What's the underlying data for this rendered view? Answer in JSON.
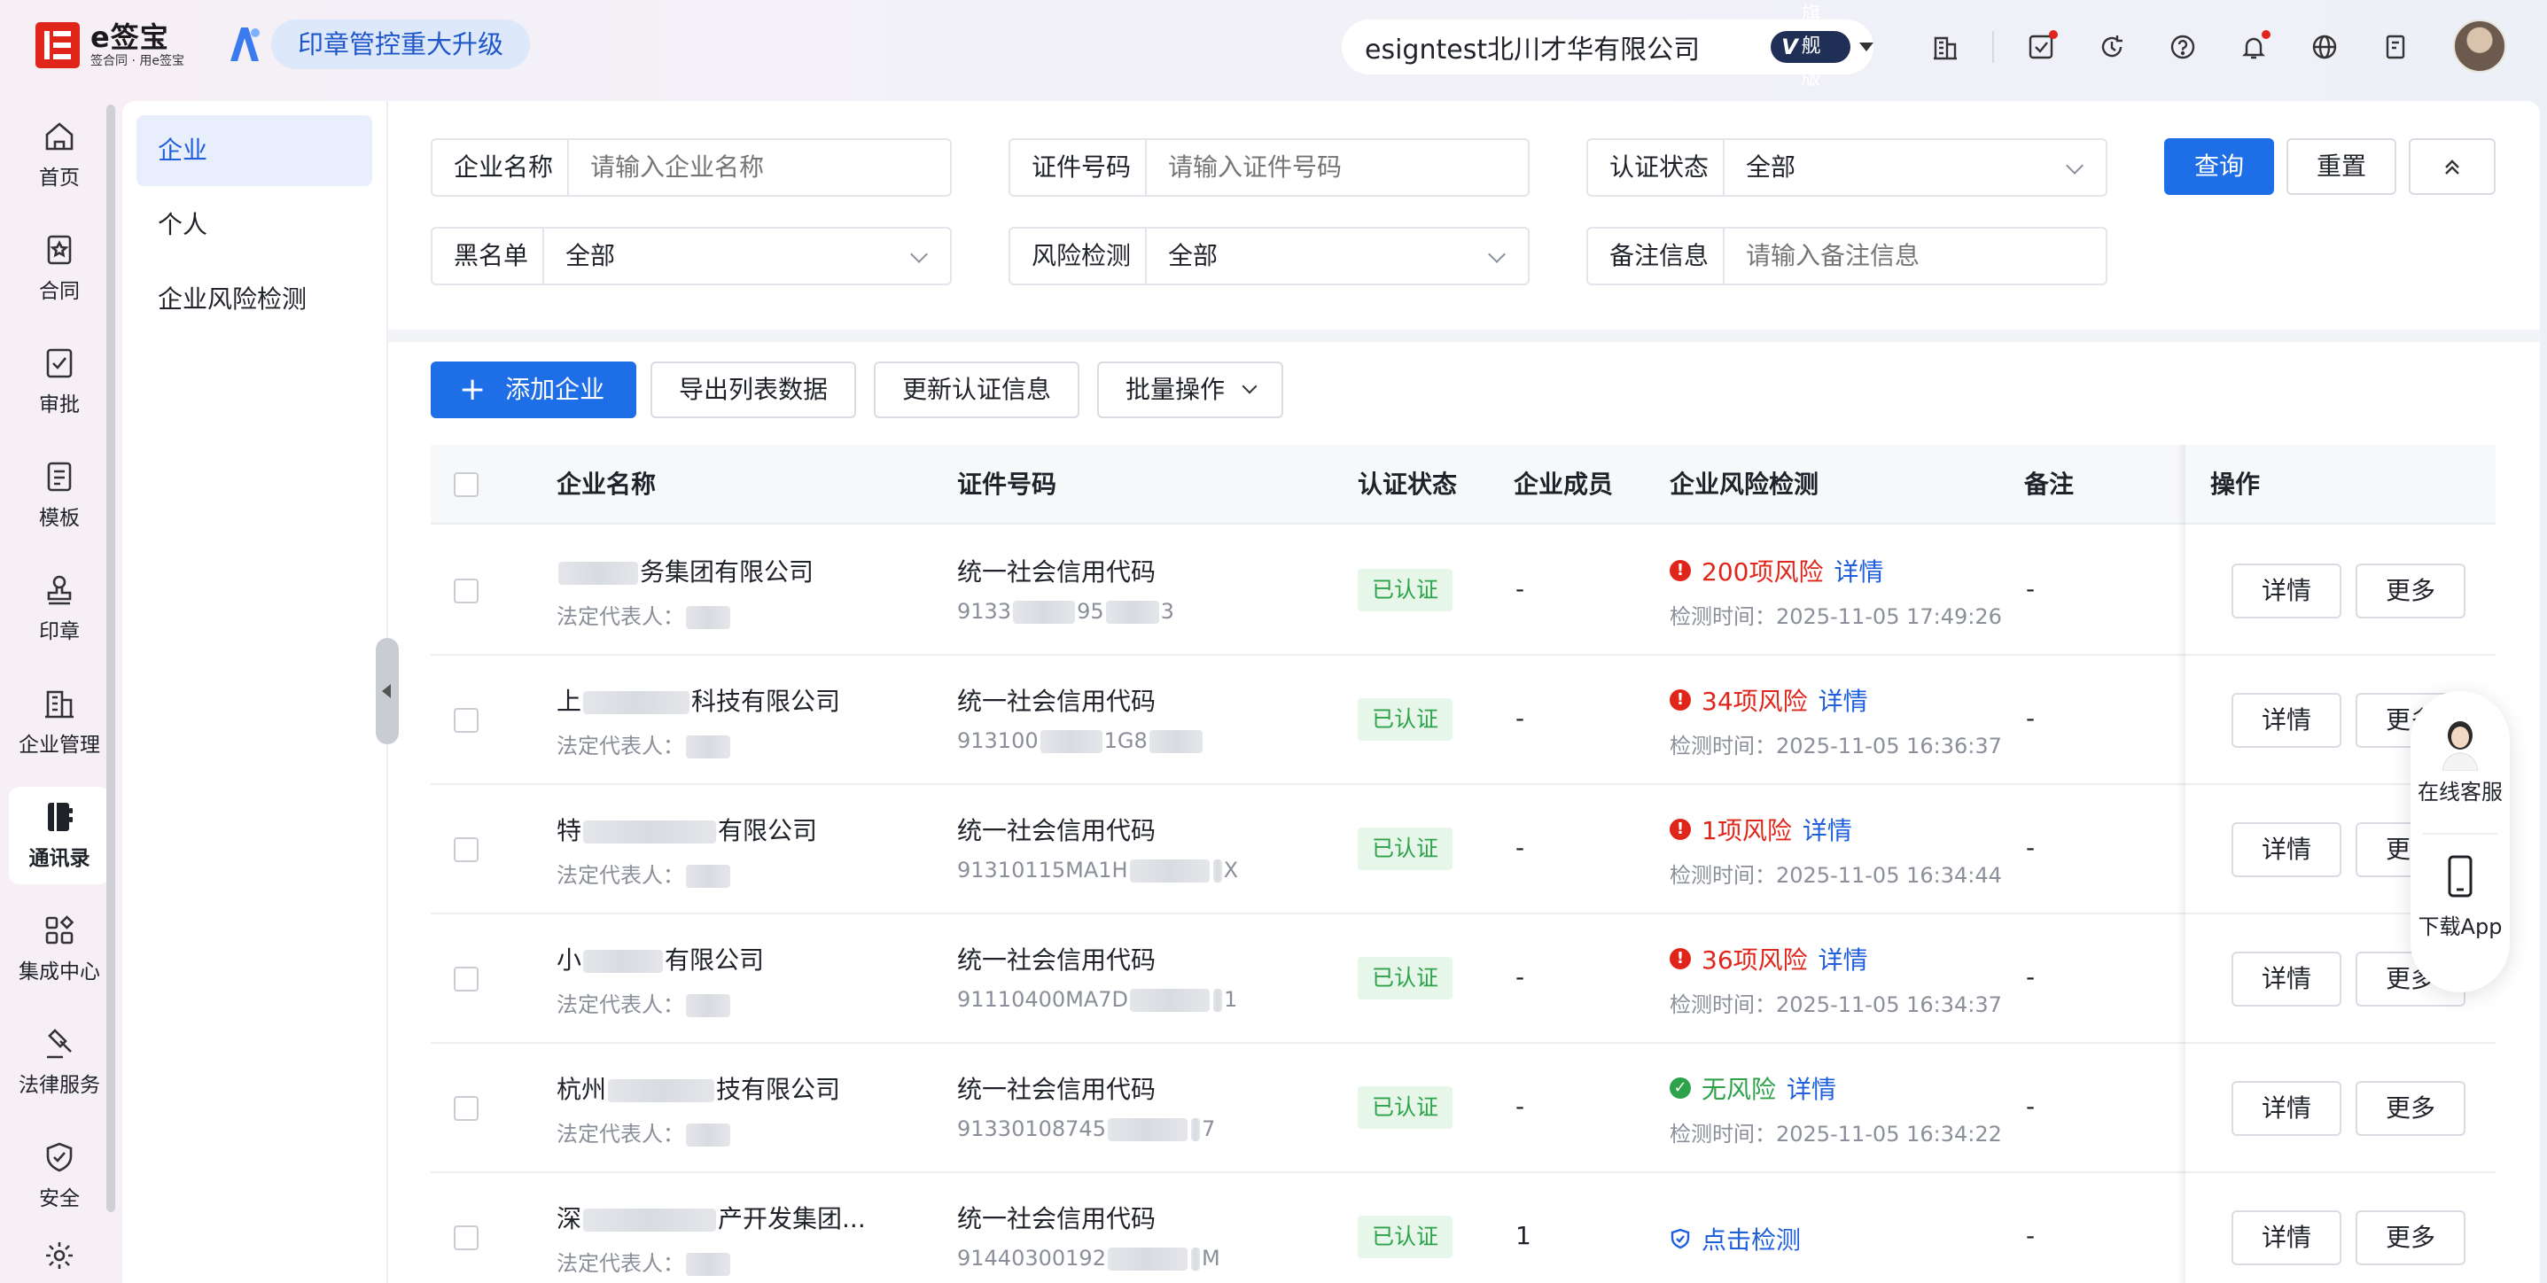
{
  "brand": {
    "logo_title": "e签宝",
    "logo_sub": "签合同 · 用e签宝",
    "promo": "印章管控重大升级"
  },
  "header": {
    "company": "esigntest北川才华有限公司",
    "tier": "旗舰版",
    "tier_mark": "V",
    "icons": [
      "building-icon",
      "todo-icon",
      "refresh-icon",
      "help-icon",
      "bell-icon",
      "globe-icon",
      "document-icon"
    ]
  },
  "rail": {
    "items": [
      {
        "label": "首页",
        "icon": "home-icon"
      },
      {
        "label": "合同",
        "icon": "contract-icon"
      },
      {
        "label": "审批",
        "icon": "approval-icon"
      },
      {
        "label": "模板",
        "icon": "template-icon"
      },
      {
        "label": "印章",
        "icon": "seal-icon"
      },
      {
        "label": "企业管理",
        "icon": "enterprise-icon"
      },
      {
        "label": "通讯录",
        "icon": "contacts-icon"
      },
      {
        "label": "集成中心",
        "icon": "integration-icon"
      },
      {
        "label": "法律服务",
        "icon": "legal-icon"
      },
      {
        "label": "安全",
        "icon": "shield-icon"
      }
    ],
    "active": "通讯录"
  },
  "subnav": {
    "items": [
      "企业",
      "个人",
      "企业风险检测"
    ],
    "active": "企业"
  },
  "filters": {
    "company_name": {
      "label": "企业名称",
      "placeholder": "请输入企业名称"
    },
    "cert_no": {
      "label": "证件号码",
      "placeholder": "请输入证件号码"
    },
    "auth_status": {
      "label": "认证状态",
      "value": "全部"
    },
    "blacklist": {
      "label": "黑名单",
      "value": "全部"
    },
    "risk_check": {
      "label": "风险检测",
      "value": "全部"
    },
    "remark": {
      "label": "备注信息",
      "placeholder": "请输入备注信息"
    },
    "query": "查询",
    "reset": "重置"
  },
  "toolbar": {
    "add": "添加企业",
    "export": "导出列表数据",
    "update": "更新认证信息",
    "batch": "批量操作"
  },
  "table": {
    "columns": {
      "name": "企业名称",
      "cert": "证件号码",
      "status": "认证状态",
      "members": "企业成员",
      "risk": "企业风险检测",
      "remark": "备注",
      "ops": "操作"
    },
    "rows": [
      {
        "name_a": "",
        "name_b": "务集团有限公司",
        "legal_a": "法定代表人：",
        "cert_type": "统一社会信用代码",
        "cert_a": "9133",
        "cert_b": "95",
        "cert_c": "3",
        "status": "已认证",
        "members": "-",
        "risk_kind": "bad",
        "risk_text": "200项风险",
        "risk_link": "详情",
        "check_time": "检测时间：2025-11-05 17:49:26",
        "remark": "-",
        "detail": "详情",
        "more": "更多"
      },
      {
        "name_a": "上",
        "name_b": "科技有限公司",
        "legal_a": "法定代表人：",
        "cert_type": "统一社会信用代码",
        "cert_a": "913100",
        "cert_b": "1G8",
        "cert_c": "",
        "status": "已认证",
        "members": "-",
        "risk_kind": "bad",
        "risk_text": "34项风险",
        "risk_link": "详情",
        "check_time": "检测时间：2025-11-05 16:36:37",
        "remark": "-",
        "detail": "详情",
        "more": "更多"
      },
      {
        "name_a": "特",
        "name_b": "有限公司",
        "legal_a": "法定代表人：",
        "cert_type": "统一社会信用代码",
        "cert_a": "91310115MA1H",
        "cert_b": "",
        "cert_c": "X",
        "status": "已认证",
        "members": "-",
        "risk_kind": "bad",
        "risk_text": "1项风险",
        "risk_link": "详情",
        "check_time": "检测时间：2025-11-05 16:34:44",
        "remark": "-",
        "detail": "详情",
        "more": "更多"
      },
      {
        "name_a": "小",
        "name_b": "有限公司",
        "legal_a": "法定代表人：",
        "cert_type": "统一社会信用代码",
        "cert_a": "91110400MA7D",
        "cert_b": "",
        "cert_c": "1",
        "status": "已认证",
        "members": "-",
        "risk_kind": "bad",
        "risk_text": "36项风险",
        "risk_link": "详情",
        "check_time": "检测时间：2025-11-05 16:34:37",
        "remark": "-",
        "detail": "详情",
        "more": "更多"
      },
      {
        "name_a": "杭州",
        "name_b": "技有限公司",
        "legal_a": "法定代表人：",
        "cert_type": "统一社会信用代码",
        "cert_a": "91330108745",
        "cert_b": "",
        "cert_c": "7",
        "status": "已认证",
        "members": "-",
        "risk_kind": "good",
        "risk_text": "无风险",
        "risk_link": "详情",
        "check_time": "检测时间：2025-11-05 16:34:22",
        "remark": "-",
        "detail": "详情",
        "more": "更多"
      },
      {
        "name_a": "深",
        "name_b": "产开发集团...",
        "legal_a": "法定代表人：",
        "cert_type": "统一社会信用代码",
        "cert_a": "91440300192",
        "cert_b": "",
        "cert_c": "M",
        "status": "已认证",
        "members": "1",
        "risk_kind": "check",
        "risk_text": "点击检测",
        "risk_link": "",
        "check_time": "",
        "remark": "-",
        "detail": "详情",
        "more": "更多"
      }
    ]
  },
  "float": {
    "service": "在线客服",
    "app": "下载App"
  },
  "colors": {
    "primary": "#1e6ee8",
    "danger": "#e0261b",
    "success": "#2ea24a",
    "link": "#1f5fdc"
  }
}
